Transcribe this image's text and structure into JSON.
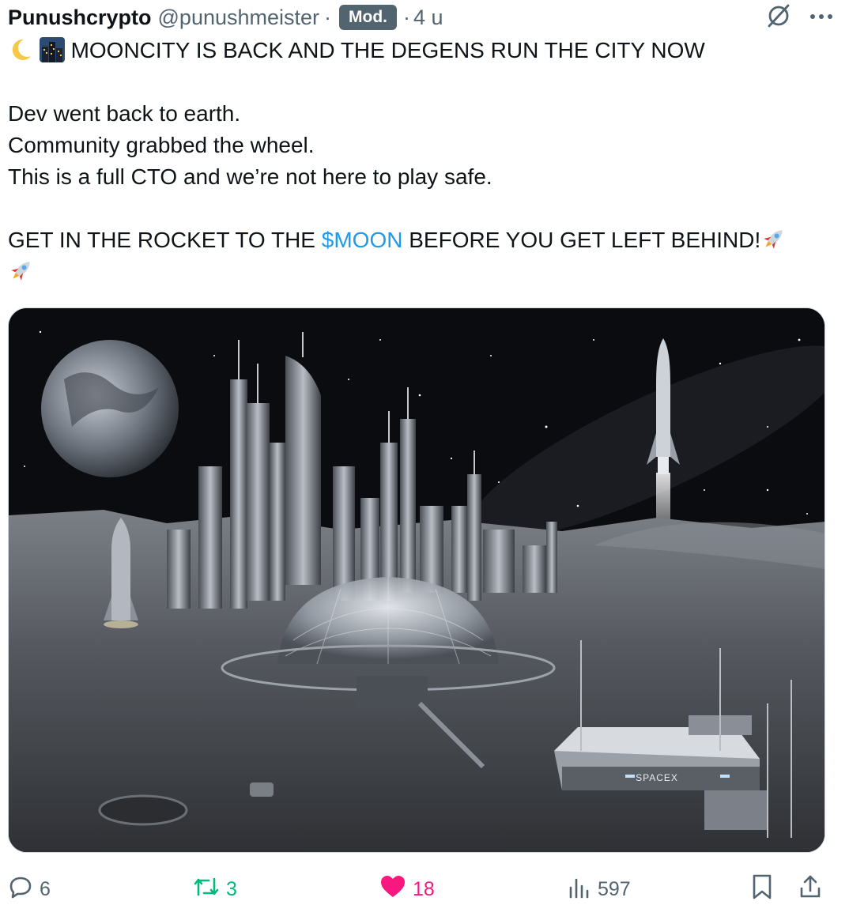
{
  "post": {
    "author_name": "Punushcrypto",
    "author_handle": "@punushmeister",
    "badge": "Mod.",
    "time": "4 u",
    "lines": [
      "MOONCITY IS BACK AND THE DEGENS RUN THE CITY NOW",
      "Dev went back to earth.",
      "Community grabbed the wheel.",
      "This is a full CTO and we’re not here to play safe.",
      "GET IN THE ROCKET TO THE",
      "$MOON",
      "BEFORE YOU GET LEFT BEHIND!"
    ],
    "image_text": "SPACEX"
  },
  "icons": {
    "header": [
      "grok-icon",
      "more-icon"
    ],
    "emoji": [
      "crescent-moon-icon",
      "city-icon",
      "rocket-icon"
    ],
    "actions": [
      "reply-icon",
      "repost-icon",
      "like-icon",
      "views-icon",
      "bookmark-icon",
      "share-icon"
    ]
  },
  "actions": {
    "replies": "6",
    "reposts": "3",
    "likes": "18",
    "views": "597"
  },
  "colors": {
    "text": "#0f1419",
    "secondary": "#536471",
    "link": "#1d9bf0",
    "repost": "#00ba7c",
    "like": "#f91880",
    "badge_bg": "#536471"
  }
}
